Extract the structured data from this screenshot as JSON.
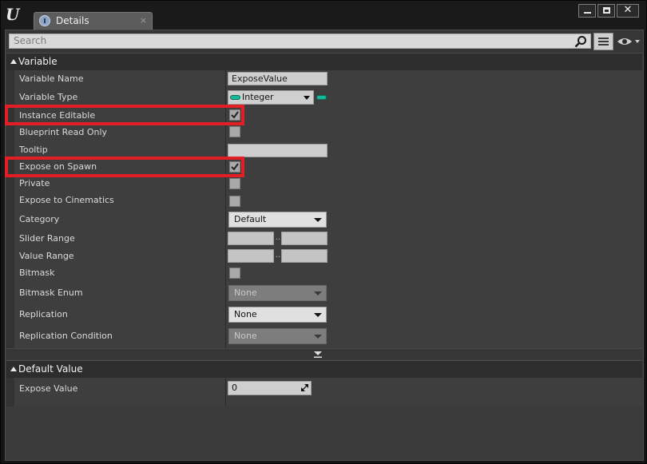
{
  "window": {
    "tab_label": "Details",
    "tab_close": "×",
    "minimize_icon": "minimize-icon",
    "maximize_icon": "maximize-icon",
    "close_icon": "close-icon",
    "close_glyph": "✕"
  },
  "search": {
    "placeholder": "Search"
  },
  "variable_section": {
    "title": "Variable",
    "rows": {
      "variable_name": {
        "label": "Variable Name",
        "value": "ExposeValue"
      },
      "variable_type": {
        "label": "Variable Type",
        "value": "Integer"
      },
      "instance_editable": {
        "label": "Instance Editable",
        "checked": true
      },
      "blueprint_read_only": {
        "label": "Blueprint Read Only",
        "checked": false
      },
      "tooltip": {
        "label": "Tooltip",
        "value": ""
      },
      "expose_on_spawn": {
        "label": "Expose on Spawn",
        "checked": true
      },
      "private": {
        "label": "Private",
        "checked": false
      },
      "expose_to_cinematics": {
        "label": "Expose to Cinematics",
        "checked": false
      },
      "category": {
        "label": "Category",
        "value": "Default"
      },
      "slider_range": {
        "label": "Slider Range",
        "min": "",
        "max": "",
        "separator": ".."
      },
      "value_range": {
        "label": "Value Range",
        "min": "",
        "max": "",
        "separator": ".."
      },
      "bitmask": {
        "label": "Bitmask",
        "checked": false
      },
      "bitmask_enum": {
        "label": "Bitmask Enum",
        "value": "None",
        "enabled": false
      },
      "replication": {
        "label": "Replication",
        "value": "None",
        "enabled": true
      },
      "replication_condition": {
        "label": "Replication Condition",
        "value": "None",
        "enabled": false
      }
    }
  },
  "default_value_section": {
    "title": "Default Value",
    "rows": {
      "expose_value": {
        "label": "Expose Value",
        "value": "0"
      }
    }
  },
  "colors": {
    "highlight": "#e31e24",
    "integer_pin": "#19b79a",
    "panel_bg": "#3e3e3e"
  }
}
